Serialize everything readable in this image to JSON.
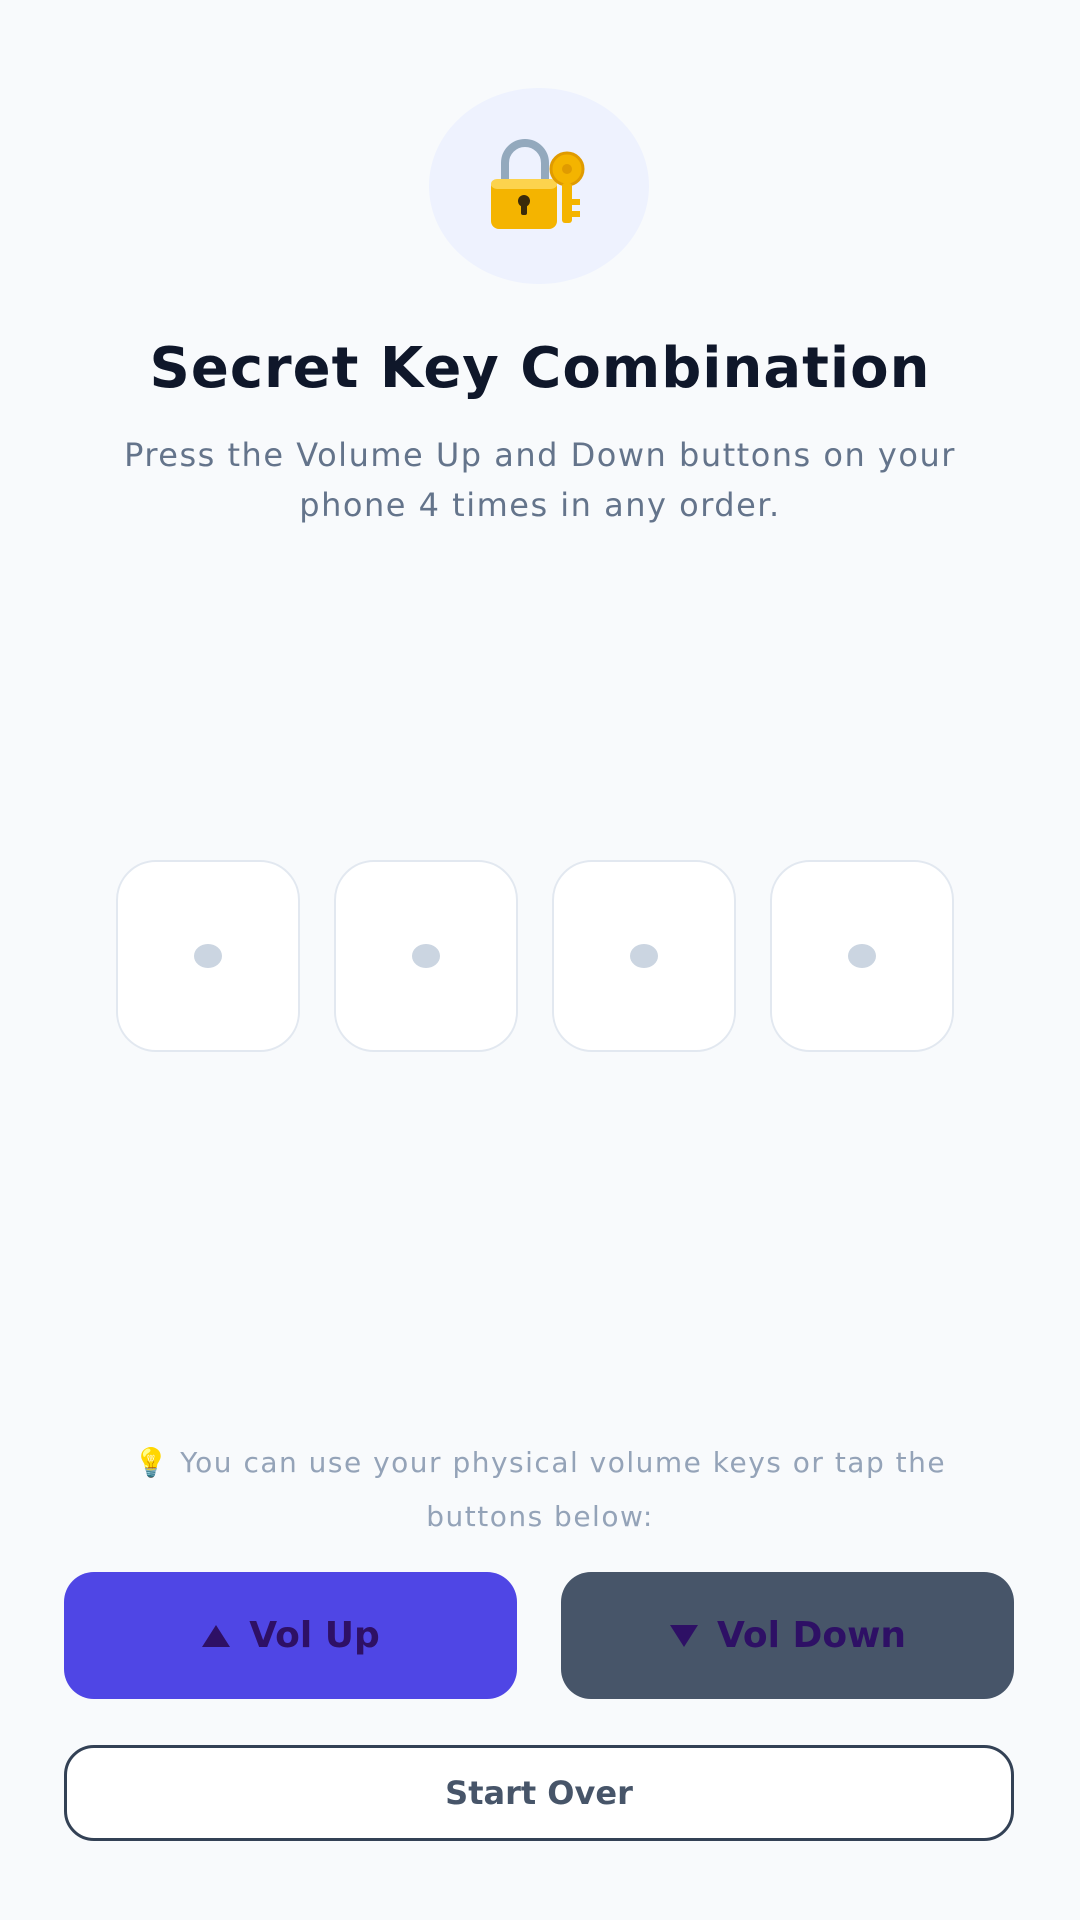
{
  "header": {
    "icon": "lock-with-key-icon",
    "title": "Secret Key Combination",
    "subtitle": "Press the Volume Up and Down buttons on your phone 4 times in any order."
  },
  "slots": [
    {
      "state": "empty"
    },
    {
      "state": "empty"
    },
    {
      "state": "empty"
    },
    {
      "state": "empty"
    }
  ],
  "hint": {
    "icon": "lightbulb-icon",
    "glyph": "💡",
    "text": "You can use your physical volume keys or tap the buttons below:"
  },
  "buttons": {
    "vol_up": {
      "label": "Vol Up",
      "icon": "triangle-up-icon",
      "color": "#4f46e5"
    },
    "vol_down": {
      "label": "Vol Down",
      "icon": "triangle-down-icon",
      "color": "#475569"
    },
    "start_over": {
      "label": "Start Over"
    }
  }
}
